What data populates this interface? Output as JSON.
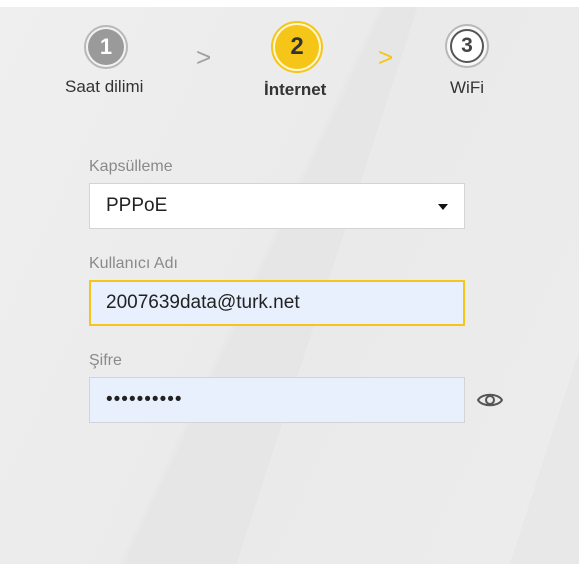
{
  "steps": [
    {
      "number": "1",
      "label": "Saat dilimi"
    },
    {
      "number": "2",
      "label": "İnternet"
    },
    {
      "number": "3",
      "label": "WiFi"
    }
  ],
  "arrows": [
    ">",
    ">"
  ],
  "colors": {
    "accent": "#f5c518",
    "inactive": "#9a9a9a"
  },
  "form": {
    "encapsulation": {
      "label": "Kapsülleme",
      "value": "PPPoE"
    },
    "username": {
      "label": "Kullanıcı Adı",
      "value": "2007639data@turk.net"
    },
    "password": {
      "label": "Şifre",
      "value": "••••••••••",
      "icon": "eye-icon"
    }
  }
}
